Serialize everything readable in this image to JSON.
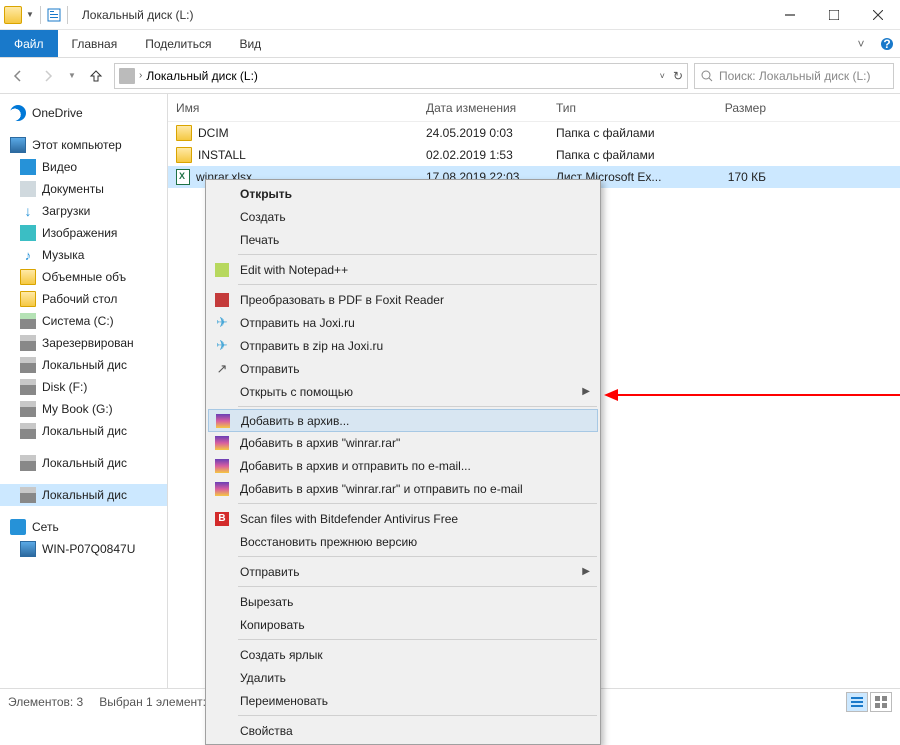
{
  "window": {
    "title": "Локальный диск (L:)"
  },
  "ribbon": {
    "file": "Файл",
    "tabs": [
      "Главная",
      "Поделиться",
      "Вид"
    ]
  },
  "nav": {
    "breadcrumb": "Локальный диск (L:)",
    "search_placeholder": "Поиск: Локальный диск (L:)"
  },
  "sidebar": [
    {
      "label": "OneDrive",
      "icon": "cloud",
      "lvl": 0
    },
    {
      "spacer": true
    },
    {
      "label": "Этот компьютер",
      "icon": "pc",
      "lvl": 0
    },
    {
      "label": "Видео",
      "icon": "video",
      "lvl": 1
    },
    {
      "label": "Документы",
      "icon": "doc",
      "lvl": 1
    },
    {
      "label": "Загрузки",
      "icon": "dl",
      "lvl": 1
    },
    {
      "label": "Изображения",
      "icon": "img",
      "lvl": 1
    },
    {
      "label": "Музыка",
      "icon": "music",
      "lvl": 1
    },
    {
      "label": "Объемные объ",
      "icon": "folder",
      "lvl": 1
    },
    {
      "label": "Рабочий стол",
      "icon": "folder",
      "lvl": 1
    },
    {
      "label": "Система (C:)",
      "icon": "drive",
      "lvl": 1
    },
    {
      "label": "Зарезервирован",
      "icon": "drive2",
      "lvl": 1
    },
    {
      "label": "Локальный дис",
      "icon": "drive2",
      "lvl": 1
    },
    {
      "label": "Disk (F:)",
      "icon": "drive2",
      "lvl": 1
    },
    {
      "label": "My Book (G:)",
      "icon": "drive2",
      "lvl": 1
    },
    {
      "label": "Локальный дис",
      "icon": "drive2",
      "lvl": 1
    },
    {
      "spacer": true
    },
    {
      "label": "Локальный дис",
      "icon": "drive2",
      "lvl": 1
    },
    {
      "spacer": true
    },
    {
      "label": "Локальный дис",
      "icon": "drive2",
      "lvl": 1,
      "selected": true
    },
    {
      "spacer": true
    },
    {
      "label": "Сеть",
      "icon": "net",
      "lvl": 0
    },
    {
      "label": "WIN-P07Q0847U",
      "icon": "pc",
      "lvl": 1
    }
  ],
  "columns": {
    "name": "Имя",
    "date": "Дата изменения",
    "type": "Тип",
    "size": "Размер"
  },
  "files": [
    {
      "name": "DCIM",
      "date": "24.05.2019 0:03",
      "type": "Папка с файлами",
      "size": "",
      "icon": "folder"
    },
    {
      "name": "INSTALL",
      "date": "02.02.2019 1:53",
      "type": "Папка с файлами",
      "size": "",
      "icon": "folder"
    },
    {
      "name": "winrar.xlsx",
      "date": "17.08.2019 22:03",
      "type": "Лист Microsoft Ex...",
      "size": "170 КБ",
      "icon": "xlsx",
      "selected": true
    }
  ],
  "context_menu": [
    {
      "label": "Открыть",
      "bold": true
    },
    {
      "label": "Создать"
    },
    {
      "label": "Печать"
    },
    {
      "sep": true
    },
    {
      "label": "Edit with Notepad++",
      "icon": "npp"
    },
    {
      "sep": true
    },
    {
      "label": "Преобразовать в PDF в Foxit Reader",
      "icon": "pdf"
    },
    {
      "label": "Отправить на Joxi.ru",
      "icon": "joxi"
    },
    {
      "label": "Отправить в zip на Joxi.ru",
      "icon": "joxi"
    },
    {
      "label": "Отправить",
      "icon": "share"
    },
    {
      "label": "Открыть с помощью",
      "submenu": true
    },
    {
      "sep": true
    },
    {
      "label": "Добавить в архив...",
      "icon": "rar",
      "highlight": true
    },
    {
      "label": "Добавить в архив \"winrar.rar\"",
      "icon": "rar"
    },
    {
      "label": "Добавить в архив и отправить по e-mail...",
      "icon": "rar"
    },
    {
      "label": "Добавить в архив \"winrar.rar\" и отправить по e-mail",
      "icon": "rar"
    },
    {
      "sep": true
    },
    {
      "label": "Scan files with Bitdefender Antivirus Free",
      "icon": "bd"
    },
    {
      "label": "Восстановить прежнюю версию"
    },
    {
      "sep": true
    },
    {
      "label": "Отправить",
      "submenu": true
    },
    {
      "sep": true
    },
    {
      "label": "Вырезать"
    },
    {
      "label": "Копировать"
    },
    {
      "sep": true
    },
    {
      "label": "Создать ярлык"
    },
    {
      "label": "Удалить"
    },
    {
      "label": "Переименовать"
    },
    {
      "sep": true
    },
    {
      "label": "Свойства"
    }
  ],
  "status": {
    "count": "Элементов: 3",
    "selected": "Выбран 1 элемент:"
  }
}
